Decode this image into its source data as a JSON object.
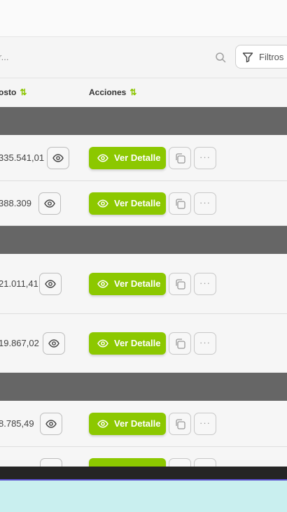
{
  "search": {
    "placeholder_fragment": "r..."
  },
  "filters": {
    "label": "Filtros"
  },
  "table": {
    "headers": {
      "cost_fragment": "osto",
      "actions": "Acciones",
      "sort_glyph": "⇅"
    },
    "detail_label": "Ver Detalle",
    "more_label": "···",
    "rows": [
      {
        "amount": "335.541,01"
      },
      {
        "amount": "388.309"
      },
      {
        "amount": "21.011,41"
      },
      {
        "amount": "19.867,02"
      },
      {
        "amount": "8.785,49"
      }
    ]
  },
  "colors": {
    "accent": "#8cc800",
    "group_bar": "#666666",
    "bottom_band": "#c9efef"
  },
  "icons": [
    "search-icon",
    "filter-icon",
    "eye-icon",
    "copy-icon",
    "more-icon"
  ]
}
